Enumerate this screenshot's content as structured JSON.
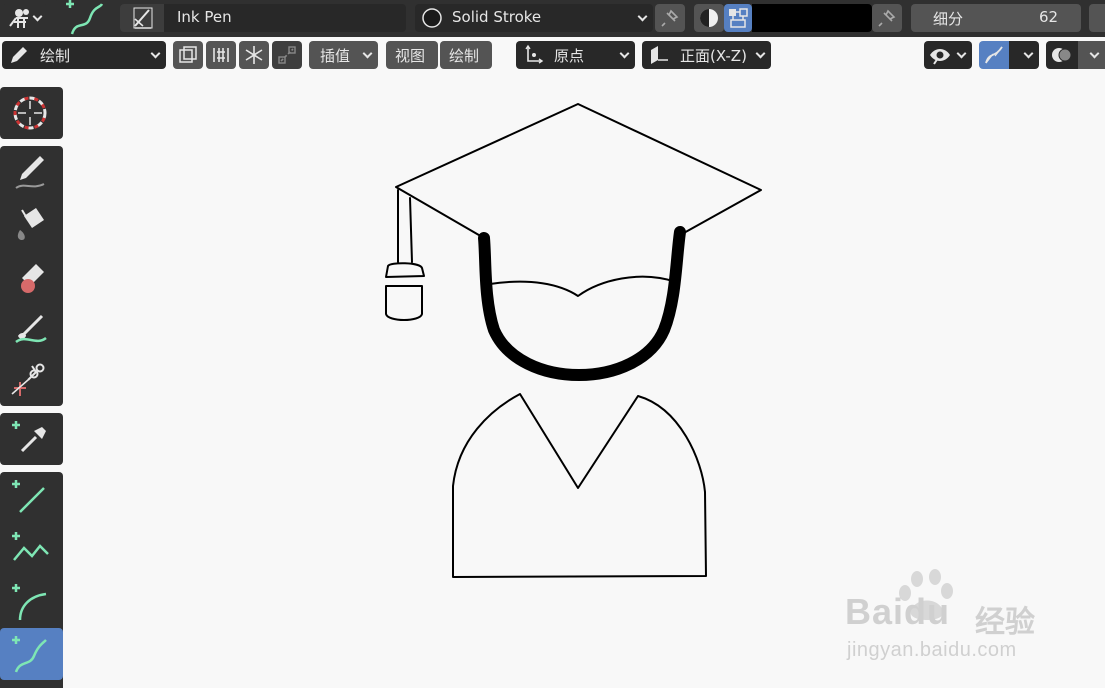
{
  "header": {
    "brush_name": "Ink Pen",
    "material_name": "Solid Stroke",
    "subdivide_label": "细分",
    "subdivide_value": "62",
    "stroke_color": "#000000"
  },
  "toolbar2": {
    "mode_label": "绘制",
    "interpolate_label": "插值",
    "view_label": "视图",
    "draw_label": "绘制",
    "origin_label": "原点",
    "plane_label": "正面(X-Z)"
  },
  "tools": [
    {
      "name": "cursor-tool"
    },
    {
      "name": "draw-tool"
    },
    {
      "name": "fill-tool"
    },
    {
      "name": "erase-tool"
    },
    {
      "name": "tint-tool"
    },
    {
      "name": "cutter-tool"
    },
    {
      "name": "eyedropper-tool"
    },
    {
      "name": "line-tool"
    },
    {
      "name": "polyline-tool"
    },
    {
      "name": "arc-tool"
    },
    {
      "name": "curve-tool"
    }
  ],
  "active_tool": "curve-tool",
  "watermark": {
    "brand": "Baidu",
    "brand_cn": "经验",
    "url": "jingyan.baidu.com"
  },
  "colors": {
    "header_bg": "#303030",
    "widget_bg": "#545454",
    "active_blue": "#5680c2",
    "canvas_bg": "#f8f8f8",
    "tool_green": "#7ee6b4"
  }
}
